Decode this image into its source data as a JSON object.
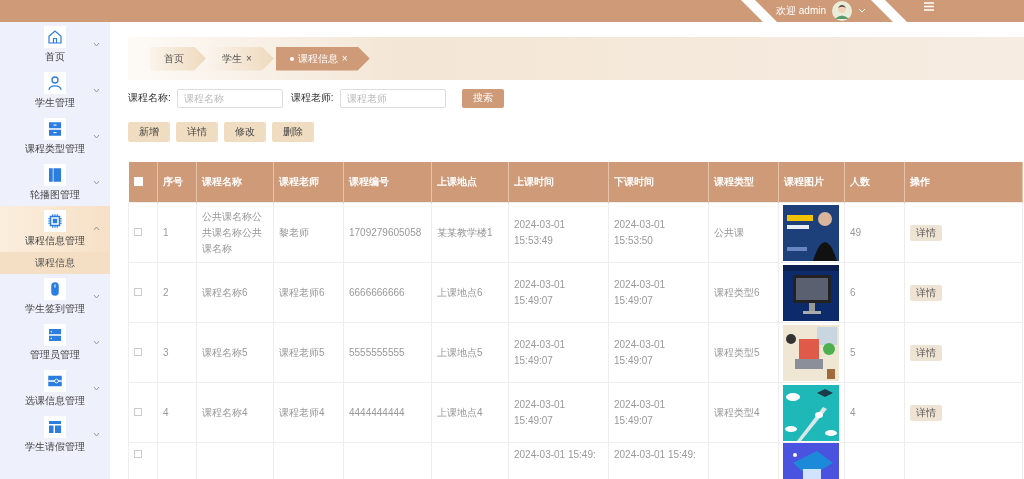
{
  "header": {
    "welcome": "欢迎 admin"
  },
  "sidebar": {
    "items": [
      {
        "label": "首页",
        "kind": "home",
        "selected": false,
        "expanded": false
      },
      {
        "label": "学生管理",
        "kind": "person",
        "selected": false,
        "expanded": false
      },
      {
        "label": "课程类型管理",
        "kind": "drawer",
        "selected": false,
        "expanded": false
      },
      {
        "label": "轮播图管理",
        "kind": "panel",
        "selected": false,
        "expanded": false
      },
      {
        "label": "课程信息管理",
        "kind": "chip",
        "selected": true,
        "expanded": true,
        "children": [
          {
            "label": "课程信息",
            "selected": true
          }
        ]
      },
      {
        "label": "学生签到管理",
        "kind": "mouse",
        "selected": false,
        "expanded": false
      },
      {
        "label": "管理员管理",
        "kind": "server",
        "selected": false,
        "expanded": false
      },
      {
        "label": "选课信息管理",
        "kind": "card",
        "selected": false,
        "expanded": false
      },
      {
        "label": "学生请假管理",
        "kind": "layout",
        "selected": false,
        "expanded": false
      }
    ]
  },
  "breadcrumbs": [
    {
      "label": "首页",
      "selected": false
    },
    {
      "label": "学生",
      "close": "×",
      "selected": false
    },
    {
      "label": "课程信息",
      "close": "×",
      "selected": true
    }
  ],
  "search": {
    "fields": [
      {
        "label": "课程名称:",
        "placeholder": "课程名称"
      },
      {
        "label": "课程老师:",
        "placeholder": "课程老师"
      }
    ],
    "button": "搜索"
  },
  "actions": [
    "新增",
    "详情",
    "修改",
    "删除"
  ],
  "table": {
    "select_all_checked": false,
    "columns": [
      "序号",
      "课程名称",
      "课程老师",
      "课程编号",
      "上课地点",
      "上课时间",
      "下课时间",
      "课程类型",
      "课程图片",
      "人数",
      "操作"
    ],
    "rows": [
      {
        "checked": false,
        "cells": [
          "1",
          "公共课名称公共课名称公共课名称",
          "黎老师",
          "1709279605058",
          "某某教学楼1",
          "2024-03-01 15:53:49",
          "2024-03-01 15:53:50",
          "公共课"
        ],
        "count": "49",
        "action": "详情"
      },
      {
        "checked": false,
        "cells": [
          "2",
          "课程名称6",
          "课程老师6",
          "6666666666",
          "上课地点6",
          "2024-03-01 15:49:07",
          "2024-03-01 15:49:07",
          "课程类型6"
        ],
        "count": "6",
        "action": "详情"
      },
      {
        "checked": false,
        "cells": [
          "3",
          "课程名称5",
          "课程老师5",
          "5555555555",
          "上课地点5",
          "2024-03-01 15:49:07",
          "2024-03-01 15:49:07",
          "课程类型5"
        ],
        "count": "5",
        "action": "详情"
      },
      {
        "checked": false,
        "cells": [
          "4",
          "课程名称4",
          "课程老师4",
          "4444444444",
          "上课地点4",
          "2024-03-01 15:49:07",
          "2024-03-01 15:49:07",
          "课程类型4"
        ],
        "count": "4",
        "action": "详情"
      },
      {
        "checked": false,
        "cells": [
          "",
          "",
          "",
          "",
          "",
          "2024-03-01 15:49:",
          "2024-03-01 15:49:",
          ""
        ],
        "count": "",
        "action": ""
      }
    ]
  }
}
